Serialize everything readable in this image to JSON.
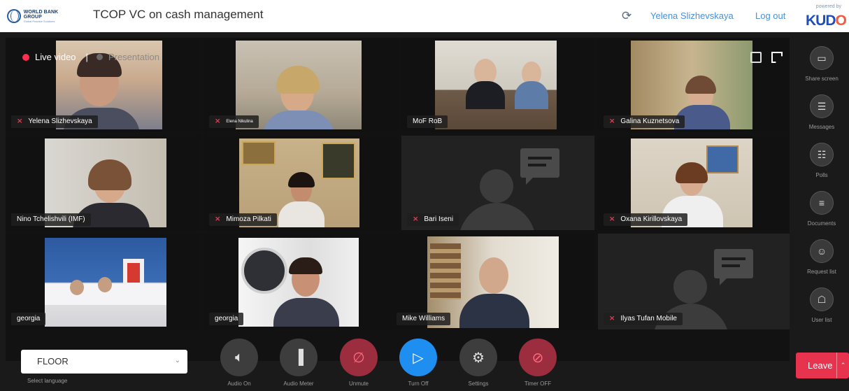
{
  "header": {
    "logo_main": "WORLD BANK GROUP",
    "logo_sub": "Global Practice Solutions",
    "title": "TCOP VC on cash management",
    "user": "Yelena Slizhevskaya",
    "logout": "Log out",
    "powered_by": "powered by",
    "brand": "KUDO"
  },
  "stage": {
    "tab_live": "Live video",
    "tab_separator": "|",
    "tab_presentation": "Presentation"
  },
  "participants": [
    {
      "name": "Yelena Slizhevskaya",
      "muted": true
    },
    {
      "name": "Elena Nikulina",
      "muted": true
    },
    {
      "name": "MoF RoB",
      "muted": false
    },
    {
      "name": "Galina Kuznetsova",
      "muted": true
    },
    {
      "name": "Nino Tchelishvili (IMF)",
      "muted": false
    },
    {
      "name": "Mimoza Pilkati",
      "muted": true
    },
    {
      "name": "Bari Iseni",
      "muted": true
    },
    {
      "name": "Oxana Kirillovskaya",
      "muted": true
    },
    {
      "name": "georgia",
      "muted": false
    },
    {
      "name": "georgia",
      "muted": false
    },
    {
      "name": "Mike Williams",
      "muted": false
    },
    {
      "name": "Ilyas Tufan Mobile",
      "muted": true
    }
  ],
  "sidebar": {
    "items": [
      {
        "label": "Share screen",
        "icon": "share-screen-icon"
      },
      {
        "label": "Messages",
        "icon": "messages-icon"
      },
      {
        "label": "Polls",
        "icon": "polls-icon"
      },
      {
        "label": "Documents",
        "icon": "documents-icon"
      },
      {
        "label": "Request list",
        "icon": "request-list-icon"
      },
      {
        "label": "User list",
        "icon": "user-list-icon"
      }
    ]
  },
  "controls": {
    "language_value": "FLOOR",
    "language_label": "Select language",
    "audio_on": "Audio On",
    "audio_meter": "Audio Meter",
    "unmute": "Unmute",
    "turn_off": "Turn Off",
    "settings": "Settings",
    "timer_off": "Timer OFF",
    "leave": "Leave"
  },
  "colors": {
    "accent_blue": "#1f8ef1",
    "leave_red": "#e8334f",
    "mute_red": "#e23b54",
    "link_blue": "#4a90d9"
  }
}
